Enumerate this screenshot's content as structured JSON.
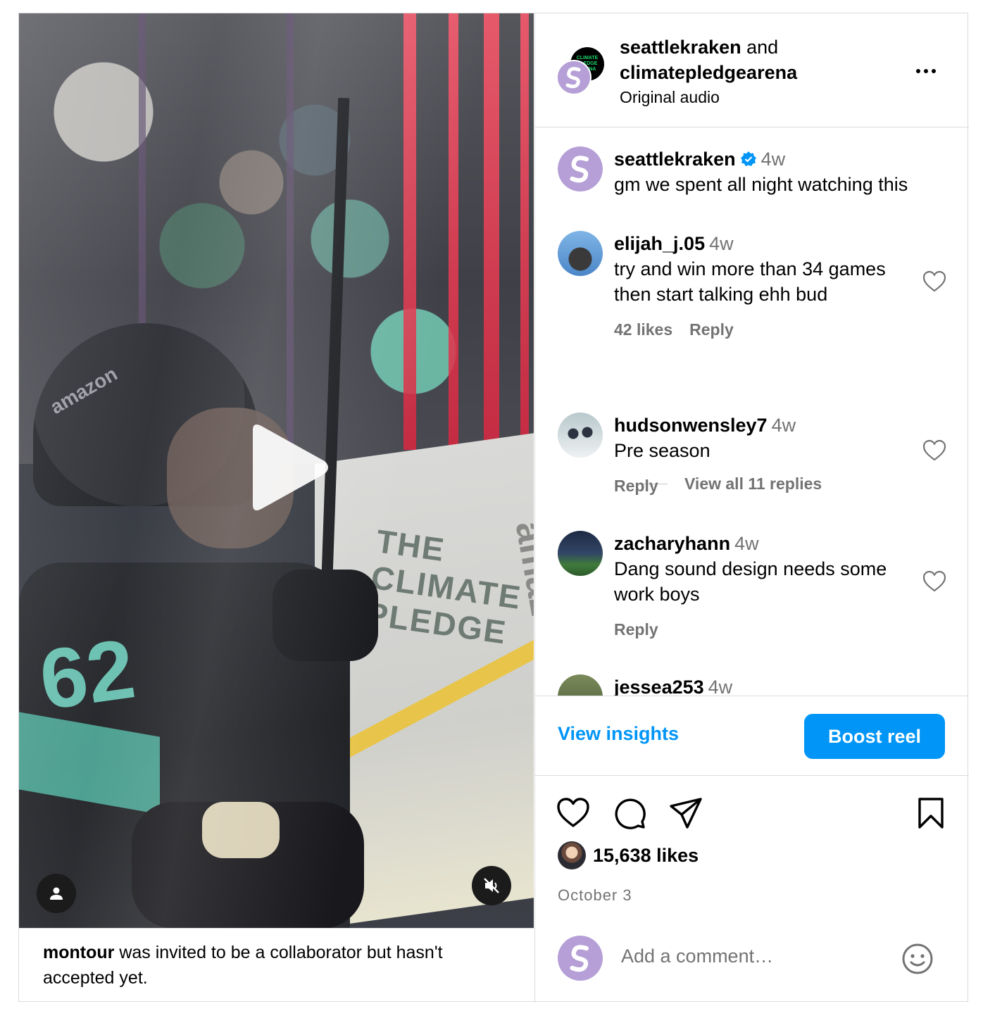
{
  "video": {
    "collab_notice": {
      "username": "montour",
      "message": " was invited to be a collaborator but hasn't accepted yet."
    },
    "icons": [
      "play-icon",
      "user-tag-icon",
      "muted-speaker-icon"
    ]
  },
  "header": {
    "user1": "seattlekraken",
    "conjunction": " and",
    "user2": "climatepledgearena",
    "audio": "Original audio",
    "back_avatar_text": "CLIMATE PLEDGE ARENA"
  },
  "comments": [
    {
      "username": "seattlekraken",
      "verified": true,
      "time": "4w",
      "text": "gm we spent all night watching this"
    },
    {
      "username": "elijah_j.05",
      "time": "4w",
      "text": "try and win more than 34 games then start talking ehh bud",
      "likes": "42 likes",
      "reply": "Reply",
      "view_replies": "View all 11 replies"
    },
    {
      "username": "hudsonwensley7",
      "time": "4w",
      "text": "Pre season",
      "reply": "Reply"
    },
    {
      "username": "zacharyhann",
      "time": "4w",
      "text": "Dang sound design needs some work boys",
      "reply": "Reply"
    },
    {
      "username": "jessea253",
      "time": "4w"
    }
  ],
  "insights": {
    "link": "View insights",
    "boost": "Boost reel"
  },
  "engagement": {
    "likes": "15,638 likes",
    "date": "October 3"
  },
  "composer": {
    "placeholder": "Add a comment…"
  },
  "colors": {
    "accent": "#0095f6",
    "muted": "#737373",
    "border": "#dbdbdb",
    "kraken_purple": "#b59fd6"
  }
}
